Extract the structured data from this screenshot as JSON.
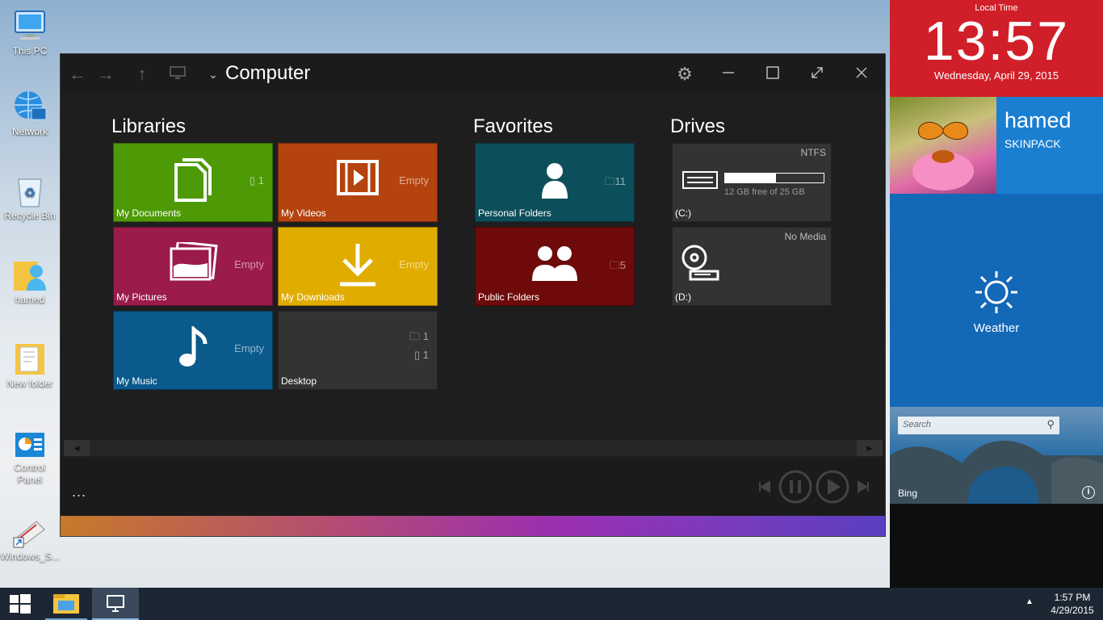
{
  "desktop_icons": [
    {
      "label": "This PC",
      "icon": "computer-icon"
    },
    {
      "label": "Network",
      "icon": "network-icon"
    },
    {
      "label": "Recycle Bin",
      "icon": "recycle-bin-icon"
    },
    {
      "label": "hamed",
      "icon": "user-folder-icon"
    },
    {
      "label": "New folder",
      "icon": "folder-icon"
    },
    {
      "label": "Control Panel",
      "icon": "control-panel-icon"
    },
    {
      "label": "Windows_S...",
      "icon": "shortcut-icon"
    }
  ],
  "window": {
    "title": "Computer",
    "sections": {
      "libraries": "Libraries",
      "favorites": "Favorites",
      "drives": "Drives"
    },
    "libraries": [
      {
        "label": "My Documents",
        "count": "1",
        "color": "#4e9a06"
      },
      {
        "label": "My Videos",
        "count": "Empty",
        "color": "#b5430f"
      },
      {
        "label": "My Pictures",
        "count": "Empty",
        "color": "#9b1b4a"
      },
      {
        "label": "My Downloads",
        "count": "Empty",
        "color": "#e0ac00"
      },
      {
        "label": "My Music",
        "count": "Empty",
        "color": "#0a5a8c"
      },
      {
        "label": "Desktop",
        "folders": "1",
        "files": "1",
        "color": "#333333"
      }
    ],
    "favorites": [
      {
        "label": "Personal Folders",
        "count": "11",
        "color": "#0c4f5b"
      },
      {
        "label": "Public Folders",
        "count": "5",
        "color": "#6f0a0a"
      }
    ],
    "drives": [
      {
        "label": "(C:)",
        "fs": "NTFS",
        "free": "12 GB free of 25 GB",
        "used_fraction": 0.52
      },
      {
        "label": "(D:)",
        "fs": "No Media"
      }
    ],
    "more": "..."
  },
  "right_panel": {
    "clock_header": "Local Time",
    "time": "13:57",
    "date": "Wednesday, April 29, 2015",
    "user_name": "hamed",
    "user_sub": "SKINPACK",
    "weather_label": "Weather",
    "search_placeholder": "Search",
    "bing_label": "Bing",
    "colors": {
      "clock": "#d01f28",
      "user": "#1a7fd1",
      "weather": "#1368b7"
    }
  },
  "taskbar": {
    "time": "1:57 PM",
    "date": "4/29/2015"
  }
}
